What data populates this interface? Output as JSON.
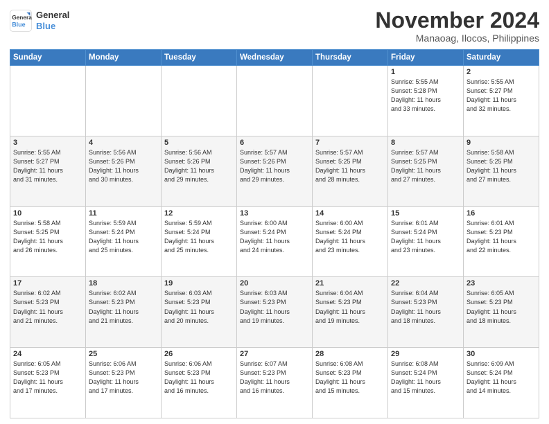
{
  "header": {
    "logo_line1": "General",
    "logo_line2": "Blue",
    "month": "November 2024",
    "location": "Manaoag, Ilocos, Philippines"
  },
  "weekdays": [
    "Sunday",
    "Monday",
    "Tuesday",
    "Wednesday",
    "Thursday",
    "Friday",
    "Saturday"
  ],
  "weeks": [
    [
      {
        "day": "",
        "info": ""
      },
      {
        "day": "",
        "info": ""
      },
      {
        "day": "",
        "info": ""
      },
      {
        "day": "",
        "info": ""
      },
      {
        "day": "",
        "info": ""
      },
      {
        "day": "1",
        "info": "Sunrise: 5:55 AM\nSunset: 5:28 PM\nDaylight: 11 hours\nand 33 minutes."
      },
      {
        "day": "2",
        "info": "Sunrise: 5:55 AM\nSunset: 5:27 PM\nDaylight: 11 hours\nand 32 minutes."
      }
    ],
    [
      {
        "day": "3",
        "info": "Sunrise: 5:55 AM\nSunset: 5:27 PM\nDaylight: 11 hours\nand 31 minutes."
      },
      {
        "day": "4",
        "info": "Sunrise: 5:56 AM\nSunset: 5:26 PM\nDaylight: 11 hours\nand 30 minutes."
      },
      {
        "day": "5",
        "info": "Sunrise: 5:56 AM\nSunset: 5:26 PM\nDaylight: 11 hours\nand 29 minutes."
      },
      {
        "day": "6",
        "info": "Sunrise: 5:57 AM\nSunset: 5:26 PM\nDaylight: 11 hours\nand 29 minutes."
      },
      {
        "day": "7",
        "info": "Sunrise: 5:57 AM\nSunset: 5:25 PM\nDaylight: 11 hours\nand 28 minutes."
      },
      {
        "day": "8",
        "info": "Sunrise: 5:57 AM\nSunset: 5:25 PM\nDaylight: 11 hours\nand 27 minutes."
      },
      {
        "day": "9",
        "info": "Sunrise: 5:58 AM\nSunset: 5:25 PM\nDaylight: 11 hours\nand 27 minutes."
      }
    ],
    [
      {
        "day": "10",
        "info": "Sunrise: 5:58 AM\nSunset: 5:25 PM\nDaylight: 11 hours\nand 26 minutes."
      },
      {
        "day": "11",
        "info": "Sunrise: 5:59 AM\nSunset: 5:24 PM\nDaylight: 11 hours\nand 25 minutes."
      },
      {
        "day": "12",
        "info": "Sunrise: 5:59 AM\nSunset: 5:24 PM\nDaylight: 11 hours\nand 25 minutes."
      },
      {
        "day": "13",
        "info": "Sunrise: 6:00 AM\nSunset: 5:24 PM\nDaylight: 11 hours\nand 24 minutes."
      },
      {
        "day": "14",
        "info": "Sunrise: 6:00 AM\nSunset: 5:24 PM\nDaylight: 11 hours\nand 23 minutes."
      },
      {
        "day": "15",
        "info": "Sunrise: 6:01 AM\nSunset: 5:24 PM\nDaylight: 11 hours\nand 23 minutes."
      },
      {
        "day": "16",
        "info": "Sunrise: 6:01 AM\nSunset: 5:23 PM\nDaylight: 11 hours\nand 22 minutes."
      }
    ],
    [
      {
        "day": "17",
        "info": "Sunrise: 6:02 AM\nSunset: 5:23 PM\nDaylight: 11 hours\nand 21 minutes."
      },
      {
        "day": "18",
        "info": "Sunrise: 6:02 AM\nSunset: 5:23 PM\nDaylight: 11 hours\nand 21 minutes."
      },
      {
        "day": "19",
        "info": "Sunrise: 6:03 AM\nSunset: 5:23 PM\nDaylight: 11 hours\nand 20 minutes."
      },
      {
        "day": "20",
        "info": "Sunrise: 6:03 AM\nSunset: 5:23 PM\nDaylight: 11 hours\nand 19 minutes."
      },
      {
        "day": "21",
        "info": "Sunrise: 6:04 AM\nSunset: 5:23 PM\nDaylight: 11 hours\nand 19 minutes."
      },
      {
        "day": "22",
        "info": "Sunrise: 6:04 AM\nSunset: 5:23 PM\nDaylight: 11 hours\nand 18 minutes."
      },
      {
        "day": "23",
        "info": "Sunrise: 6:05 AM\nSunset: 5:23 PM\nDaylight: 11 hours\nand 18 minutes."
      }
    ],
    [
      {
        "day": "24",
        "info": "Sunrise: 6:05 AM\nSunset: 5:23 PM\nDaylight: 11 hours\nand 17 minutes."
      },
      {
        "day": "25",
        "info": "Sunrise: 6:06 AM\nSunset: 5:23 PM\nDaylight: 11 hours\nand 17 minutes."
      },
      {
        "day": "26",
        "info": "Sunrise: 6:06 AM\nSunset: 5:23 PM\nDaylight: 11 hours\nand 16 minutes."
      },
      {
        "day": "27",
        "info": "Sunrise: 6:07 AM\nSunset: 5:23 PM\nDaylight: 11 hours\nand 16 minutes."
      },
      {
        "day": "28",
        "info": "Sunrise: 6:08 AM\nSunset: 5:23 PM\nDaylight: 11 hours\nand 15 minutes."
      },
      {
        "day": "29",
        "info": "Sunrise: 6:08 AM\nSunset: 5:24 PM\nDaylight: 11 hours\nand 15 minutes."
      },
      {
        "day": "30",
        "info": "Sunrise: 6:09 AM\nSunset: 5:24 PM\nDaylight: 11 hours\nand 14 minutes."
      }
    ]
  ]
}
